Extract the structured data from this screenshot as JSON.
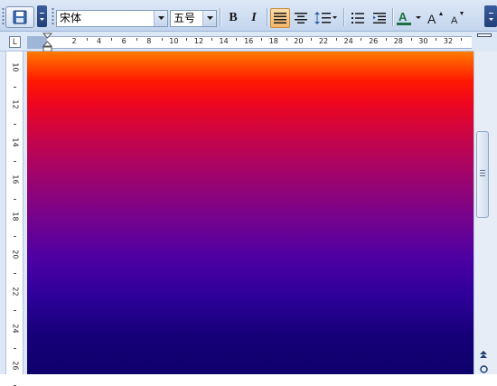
{
  "toolbar": {
    "font_name": "宋体",
    "font_size": "五号",
    "bold_label": "B",
    "italic_label": "I",
    "font_color": "#1f6f43"
  },
  "ruler": {
    "corner_label": "L",
    "ticks": [
      "2",
      "4",
      "6",
      "8",
      "10",
      "12",
      "14",
      "16",
      "18",
      "20",
      "22",
      "24",
      "26",
      "28",
      "30",
      "32"
    ]
  },
  "vruler": {
    "ticks": [
      "10",
      "12",
      "14",
      "16",
      "18",
      "20",
      "22",
      "24",
      "26"
    ]
  },
  "page": {
    "gradient_top": "#ff7b00",
    "gradient_mid": "#9a0470",
    "gradient_bottom": "#0e006c"
  }
}
